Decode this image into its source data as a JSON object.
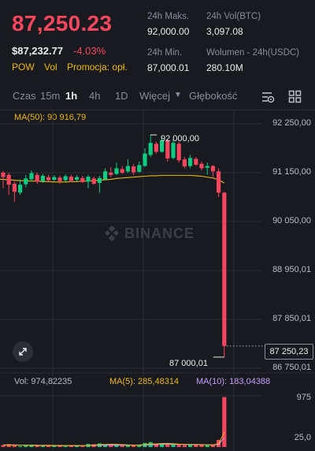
{
  "header": {
    "last_price": "87,250.23",
    "usd_price": "$87,232.77",
    "change_pct": "-4.03%",
    "tags": [
      "POW",
      "Vol",
      "Promocja: opł."
    ]
  },
  "stats": [
    {
      "label": "24h Maks.",
      "value": "92,000.00"
    },
    {
      "label": "24h Vol(BTC)",
      "value": "3,097.08"
    },
    {
      "label": "24h Min.",
      "value": "87,000.01"
    },
    {
      "label": "Wolumen - 24h(USDC)",
      "value": "280.10M"
    }
  ],
  "tabs": [
    {
      "label": "Czas",
      "active": false
    },
    {
      "label": "15m",
      "active": false
    },
    {
      "label": "1h",
      "active": true
    },
    {
      "label": "4h",
      "active": false
    },
    {
      "label": "1D",
      "active": false
    },
    {
      "label": "Więcej",
      "active": false
    },
    {
      "label": "Głębokość",
      "active": false
    }
  ],
  "indicators": {
    "ma50": "MA(50): 90 916,79",
    "vol": "Vol: 974,82235",
    "ma5": "MA(5): 285,48314",
    "ma10": "MA(10): 183,04388"
  },
  "price_axis": [
    "92 250,00",
    "91 150,00",
    "90 050,00",
    "88 950,01",
    "87 850,01",
    "86 750,01"
  ],
  "volume_axis": [
    "975",
    "25,0"
  ],
  "annotations": {
    "high": "92 000,00",
    "low": "87 000,01",
    "current_price_tag": "87 250,23"
  },
  "watermark": "BINANCE",
  "colors": {
    "up": "#0ecb81",
    "down": "#f6465d",
    "ma50": "#f0b90b",
    "ma5": "#f0b90b",
    "ma10": "#c99bff",
    "accent": "#f0b90b"
  },
  "chart_data": {
    "type": "candlestick",
    "interval": "1h",
    "ylim": [
      86750,
      92250
    ],
    "candles": [
      {
        "o": 91150,
        "c": 91050,
        "h": 91190,
        "l": 90800
      },
      {
        "o": 91100,
        "c": 90880,
        "h": 91150,
        "l": 90650
      },
      {
        "o": 90900,
        "c": 90720,
        "h": 90950,
        "l": 90500
      },
      {
        "o": 90700,
        "c": 90880,
        "h": 91000,
        "l": 90650
      },
      {
        "o": 90890,
        "c": 91020,
        "h": 91100,
        "l": 90820
      },
      {
        "o": 91000,
        "c": 91140,
        "h": 91200,
        "l": 90950
      },
      {
        "o": 91100,
        "c": 90950,
        "h": 91150,
        "l": 90900
      },
      {
        "o": 90960,
        "c": 91080,
        "h": 91120,
        "l": 90920
      },
      {
        "o": 91050,
        "c": 90980,
        "h": 91100,
        "l": 90950
      },
      {
        "o": 90990,
        "c": 91050,
        "h": 91090,
        "l": 90960
      },
      {
        "o": 91040,
        "c": 90960,
        "h": 91080,
        "l": 90900
      },
      {
        "o": 90980,
        "c": 91070,
        "h": 91110,
        "l": 90950
      },
      {
        "o": 91060,
        "c": 90970,
        "h": 91100,
        "l": 90940
      },
      {
        "o": 90990,
        "c": 91050,
        "h": 91090,
        "l": 90960
      },
      {
        "o": 91030,
        "c": 90940,
        "h": 91080,
        "l": 90920
      },
      {
        "o": 90950,
        "c": 91060,
        "h": 91100,
        "l": 90800
      },
      {
        "o": 91020,
        "c": 90900,
        "h": 91060,
        "l": 90880
      },
      {
        "o": 90920,
        "c": 91030,
        "h": 91080,
        "l": 90700
      },
      {
        "o": 91000,
        "c": 91180,
        "h": 91250,
        "l": 90980
      },
      {
        "o": 91150,
        "c": 91100,
        "h": 91280,
        "l": 91050
      },
      {
        "o": 91120,
        "c": 91250,
        "h": 91380,
        "l": 91100
      },
      {
        "o": 91230,
        "c": 91150,
        "h": 91300,
        "l": 91120
      },
      {
        "o": 91180,
        "c": 91300,
        "h": 91450,
        "l": 91150
      },
      {
        "o": 91290,
        "c": 91160,
        "h": 91350,
        "l": 91100
      },
      {
        "o": 91170,
        "c": 91320,
        "h": 91400,
        "l": 91150
      },
      {
        "o": 91300,
        "c": 91580,
        "h": 91700,
        "l": 91280
      },
      {
        "o": 91550,
        "c": 91820,
        "h": 92000,
        "l": 91500
      },
      {
        "o": 91800,
        "c": 91620,
        "h": 91850,
        "l": 91580
      },
      {
        "o": 91620,
        "c": 91880,
        "h": 91950,
        "l": 91600
      },
      {
        "o": 91880,
        "c": 91470,
        "h": 91900,
        "l": 91400
      },
      {
        "o": 91480,
        "c": 91820,
        "h": 91900,
        "l": 91450
      },
      {
        "o": 91800,
        "c": 91430,
        "h": 91850,
        "l": 91380
      },
      {
        "o": 91450,
        "c": 91290,
        "h": 91500,
        "l": 91250
      },
      {
        "o": 91300,
        "c": 91480,
        "h": 91550,
        "l": 91250
      },
      {
        "o": 91460,
        "c": 91330,
        "h": 91500,
        "l": 91300
      },
      {
        "o": 91350,
        "c": 91250,
        "h": 91400,
        "l": 91200
      },
      {
        "o": 91260,
        "c": 91300,
        "h": 91380,
        "l": 91100
      },
      {
        "o": 91300,
        "c": 91180,
        "h": 91320,
        "l": 91050
      },
      {
        "o": 91180,
        "c": 90700,
        "h": 91250,
        "l": 90600
      },
      {
        "o": 90700,
        "c": 87250,
        "h": 90720,
        "l": 87000
      }
    ],
    "ma50": [
      91000,
      90990,
      90980,
      90970,
      90970,
      90960,
      90960,
      90950,
      90950,
      90940,
      90940,
      90940,
      90950,
      90950,
      90960,
      90960,
      90970,
      90980,
      90990,
      91000,
      91020,
      91030,
      91040,
      91050,
      91060,
      91070,
      91080,
      91080,
      91090,
      91090,
      91090,
      91090,
      91090,
      91090,
      91080,
      91070,
      91050,
      91030,
      90990,
      90917
    ],
    "volume": {
      "ylim": [
        0,
        1000
      ],
      "values": [
        40,
        55,
        35,
        20,
        30,
        45,
        25,
        20,
        30,
        25,
        35,
        20,
        25,
        30,
        20,
        60,
        55,
        70,
        45,
        40,
        50,
        35,
        40,
        30,
        45,
        80,
        95,
        60,
        70,
        55,
        50,
        45,
        40,
        45,
        50,
        40,
        35,
        45,
        140,
        975
      ],
      "ma5": [
        40,
        42,
        41,
        38,
        36,
        37,
        31,
        28,
        30,
        29,
        27,
        26,
        27,
        27,
        26,
        34,
        38,
        47,
        50,
        54,
        52,
        48,
        42,
        39,
        40,
        48,
        58,
        62,
        70,
        72,
        66,
        56,
        52,
        49,
        46,
        44,
        42,
        43,
        62,
        285
      ],
      "ma10": [
        40,
        41,
        40,
        39,
        38,
        38,
        37,
        35,
        34,
        33,
        32,
        31,
        30,
        30,
        29,
        31,
        32,
        35,
        37,
        37,
        37,
        36,
        37,
        37,
        38,
        41,
        45,
        48,
        50,
        52,
        52,
        51,
        51,
        51,
        51,
        48,
        45,
        43,
        50,
        183
      ]
    }
  }
}
